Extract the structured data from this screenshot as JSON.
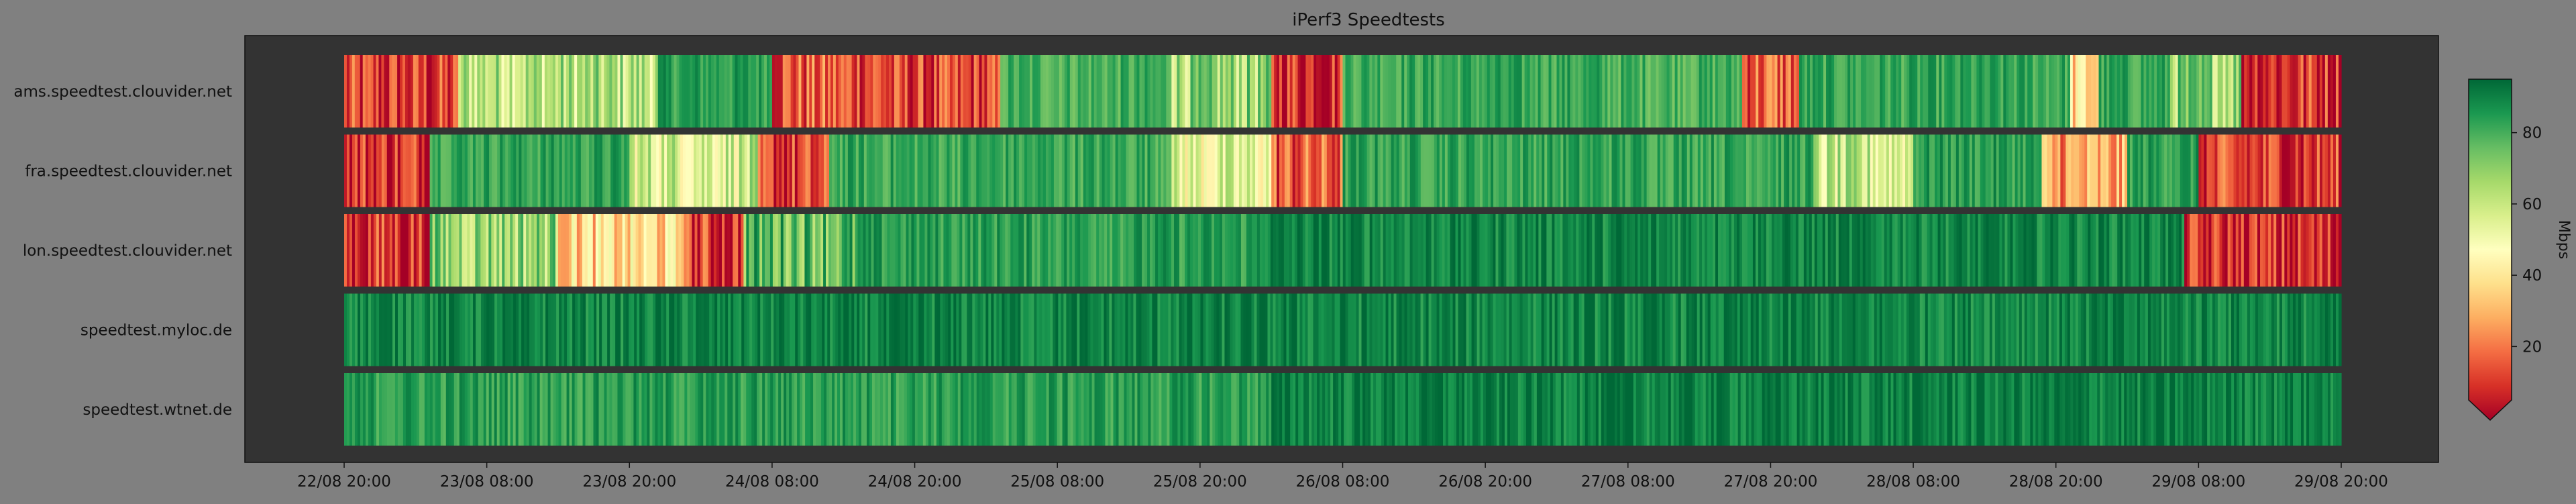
{
  "chart_data": {
    "type": "heatmap",
    "title": "iPerf3 Speedtests",
    "xlabel": "",
    "ylabel": "",
    "rows": [
      "ams.speedtest.clouvider.net",
      "fra.speedtest.clouvider.net",
      "lon.speedtest.clouvider.net",
      "speedtest.myloc.de",
      "speedtest.wtnet.de"
    ],
    "x_tick_labels": [
      "22/08 20:00",
      "23/08 08:00",
      "23/08 20:00",
      "24/08 08:00",
      "24/08 20:00",
      "25/08 08:00",
      "25/08 20:00",
      "26/08 08:00",
      "26/08 20:00",
      "27/08 08:00",
      "27/08 20:00",
      "28/08 08:00",
      "28/08 20:00",
      "29/08 08:00",
      "29/08 20:00"
    ],
    "time_range": [
      "22/08 20:00",
      "29/08 20:00"
    ],
    "value_unit": "Mbps",
    "colorbar": {
      "label": "Mbps",
      "ticks": [
        20,
        40,
        60,
        80
      ],
      "range": [
        5,
        95
      ],
      "colormap": "RdYlGn",
      "extend": "min",
      "stops": [
        "#a50026",
        "#d73027",
        "#f46d43",
        "#fdae61",
        "#fee08b",
        "#ffffbf",
        "#d9ef8b",
        "#a6d96a",
        "#66bd63",
        "#1a9850",
        "#006837"
      ]
    },
    "series": [
      {
        "name": "ams.speedtest.clouvider.net",
        "segments": [
          {
            "from": 0.0,
            "to": 0.8,
            "value": 15
          },
          {
            "from": 0.8,
            "to": 2.2,
            "value": 65
          },
          {
            "from": 2.2,
            "to": 3.0,
            "value": 86
          },
          {
            "from": 3.0,
            "to": 3.8,
            "value": 20
          },
          {
            "from": 3.8,
            "to": 4.6,
            "value": 15
          },
          {
            "from": 4.6,
            "to": 5.8,
            "value": 82
          },
          {
            "from": 5.8,
            "to": 6.5,
            "value": 68
          },
          {
            "from": 6.5,
            "to": 7.0,
            "value": 15
          },
          {
            "from": 7.0,
            "to": 8.8,
            "value": 84
          },
          {
            "from": 8.8,
            "to": 9.8,
            "value": 82
          },
          {
            "from": 9.8,
            "to": 10.2,
            "value": 22
          },
          {
            "from": 10.2,
            "to": 11.5,
            "value": 84
          },
          {
            "from": 11.5,
            "to": 12.1,
            "value": 84
          },
          {
            "from": 12.1,
            "to": 12.3,
            "value": 40
          },
          {
            "from": 12.3,
            "to": 12.8,
            "value": 84
          },
          {
            "from": 12.8,
            "to": 13.3,
            "value": 70
          },
          {
            "from": 13.3,
            "to": 14.0,
            "value": 15
          }
        ]
      },
      {
        "name": "fra.speedtest.clouvider.net",
        "segments": [
          {
            "from": 0.0,
            "to": 0.6,
            "value": 15
          },
          {
            "from": 0.6,
            "to": 2.0,
            "value": 85
          },
          {
            "from": 2.0,
            "to": 2.9,
            "value": 60
          },
          {
            "from": 2.9,
            "to": 3.4,
            "value": 15
          },
          {
            "from": 3.4,
            "to": 5.8,
            "value": 84
          },
          {
            "from": 5.8,
            "to": 6.5,
            "value": 55
          },
          {
            "from": 6.5,
            "to": 7.0,
            "value": 20
          },
          {
            "from": 7.0,
            "to": 10.3,
            "value": 85
          },
          {
            "from": 10.3,
            "to": 11.0,
            "value": 60
          },
          {
            "from": 11.0,
            "to": 11.9,
            "value": 86
          },
          {
            "from": 11.9,
            "to": 12.5,
            "value": 30
          },
          {
            "from": 12.5,
            "to": 13.0,
            "value": 86
          },
          {
            "from": 13.0,
            "to": 14.0,
            "value": 15
          }
        ]
      },
      {
        "name": "lon.speedtest.clouvider.net",
        "segments": [
          {
            "from": 0.0,
            "to": 0.6,
            "value": 15
          },
          {
            "from": 0.6,
            "to": 1.5,
            "value": 70
          },
          {
            "from": 1.5,
            "to": 2.4,
            "value": 40
          },
          {
            "from": 2.4,
            "to": 2.8,
            "value": 15
          },
          {
            "from": 2.8,
            "to": 3.6,
            "value": 78
          },
          {
            "from": 3.6,
            "to": 6.4,
            "value": 86
          },
          {
            "from": 6.4,
            "to": 12.9,
            "value": 91
          },
          {
            "from": 12.9,
            "to": 14.0,
            "value": 12
          }
        ]
      },
      {
        "name": "speedtest.myloc.de",
        "segments": [
          {
            "from": 0.0,
            "to": 14.0,
            "value": 91
          }
        ]
      },
      {
        "name": "speedtest.wtnet.de",
        "segments": [
          {
            "from": 0.0,
            "to": 6.5,
            "value": 86
          },
          {
            "from": 6.5,
            "to": 14.0,
            "value": 92
          }
        ]
      }
    ],
    "value_note_units": "x values are in ticks index units (0 = 22/08 20:00, each unit = 12 hours)"
  }
}
